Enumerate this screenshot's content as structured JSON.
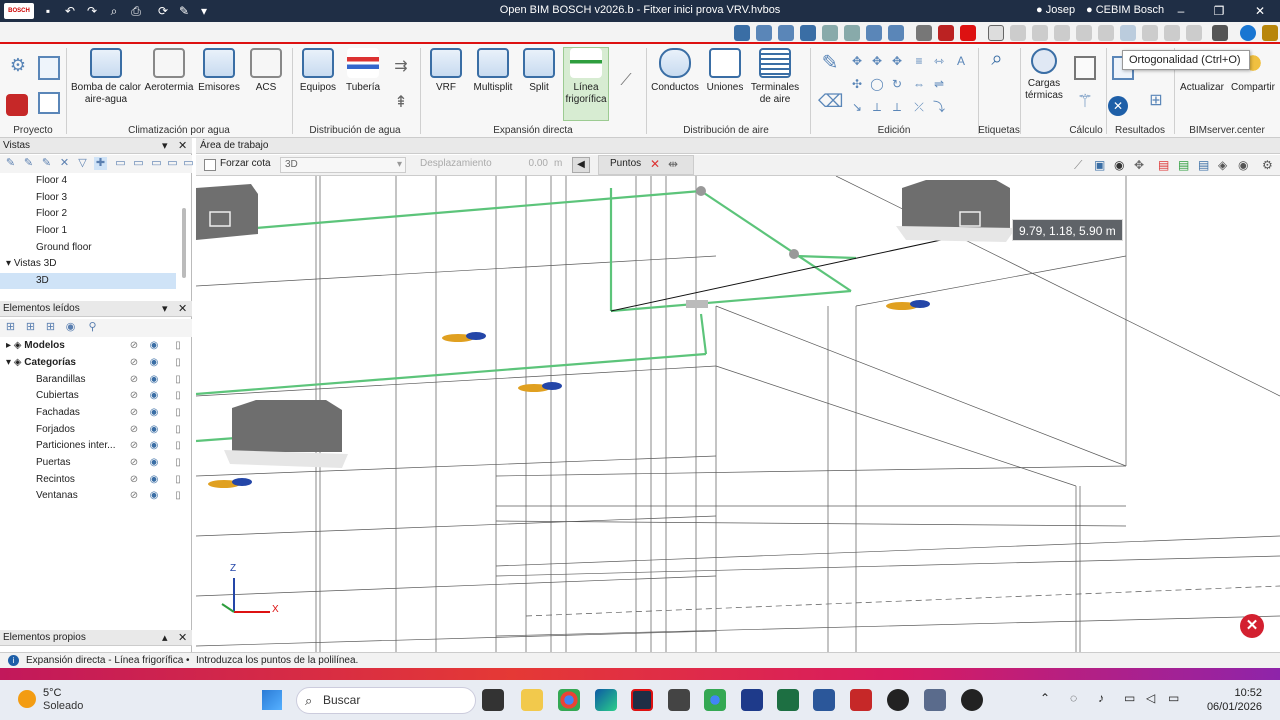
{
  "window": {
    "title": "Open BIM BOSCH v2026.b - Fitxer inici prova VRV.hvbos",
    "user": "Josep",
    "account": "CEBIM Bosch",
    "logo_text": "BOSCH"
  },
  "tooltip": "Ortogonalidad (Ctrl+O)",
  "ribbon": {
    "groups": [
      {
        "label": "Proyecto"
      },
      {
        "label": "Climatización por agua"
      },
      {
        "label": "Distribución de agua"
      },
      {
        "label": "Expansión directa"
      },
      {
        "label": "Distribución de aire"
      },
      {
        "label": "Edición"
      },
      {
        "label": "Etiquetas"
      },
      {
        "label": "Cálculo"
      },
      {
        "label": "Resultados"
      },
      {
        "label": "BIMserver.center"
      }
    ],
    "buttons": {
      "bomba": "Bomba de calor aire-agua",
      "aerotermia": "Aerotermia",
      "emisores": "Emisores",
      "acs": "ACS",
      "equipos": "Equipos",
      "tuberia": "Tubería",
      "vrf": "VRF",
      "multisplit": "Multisplit",
      "split": "Split",
      "linea": "Línea frigorífica",
      "conductos": "Conductos",
      "uniones": "Uniones",
      "terminales": "Terminales de aire",
      "cargas": "Cargas térmicas",
      "actualizar": "Actualizar",
      "compartir": "Compartir"
    }
  },
  "left_panel": {
    "vistas_title": "Vistas",
    "tree": [
      "Floor 4",
      "Floor 3",
      "Floor 2",
      "Floor 1",
      "Ground floor"
    ],
    "vistas3d": "Vistas 3D",
    "view3d": "3D",
    "elementos_title": "Elementos leídos",
    "modelos": "Modelos",
    "categorias": "Categorías",
    "categories": [
      "Barandillas",
      "Cubiertas",
      "Fachadas",
      "Forjados",
      "Particiones inter...",
      "Puertas",
      "Recintos",
      "Ventanas"
    ],
    "propios_title": "Elementos propios"
  },
  "workarea": {
    "title": "Área de trabajo",
    "forzar_cota": "Forzar cota",
    "mode_value": "3D",
    "desplazamiento_label": "Desplazamiento",
    "desplazamiento_value": "0.00",
    "unit": "m",
    "puntos": "Puntos",
    "coordinate_readout": "9.79, 1.18, 5.90 m",
    "axis_z": "Z",
    "axis_x": "X"
  },
  "statusbar": {
    "context": "Expansión directa - Línea frigorífica",
    "hint": "Introduzca los puntos de la polilínea."
  },
  "taskbar": {
    "weather_temp": "5°C",
    "weather_desc": "Soleado",
    "search_placeholder": "Buscar",
    "time": "10:52",
    "date": "06/01/2026"
  },
  "colors": {
    "titlebar": "#1f2e45",
    "accent_red": "#dd1111",
    "pipe_green": "#5cc47a",
    "selection": "#cfe3f7"
  }
}
